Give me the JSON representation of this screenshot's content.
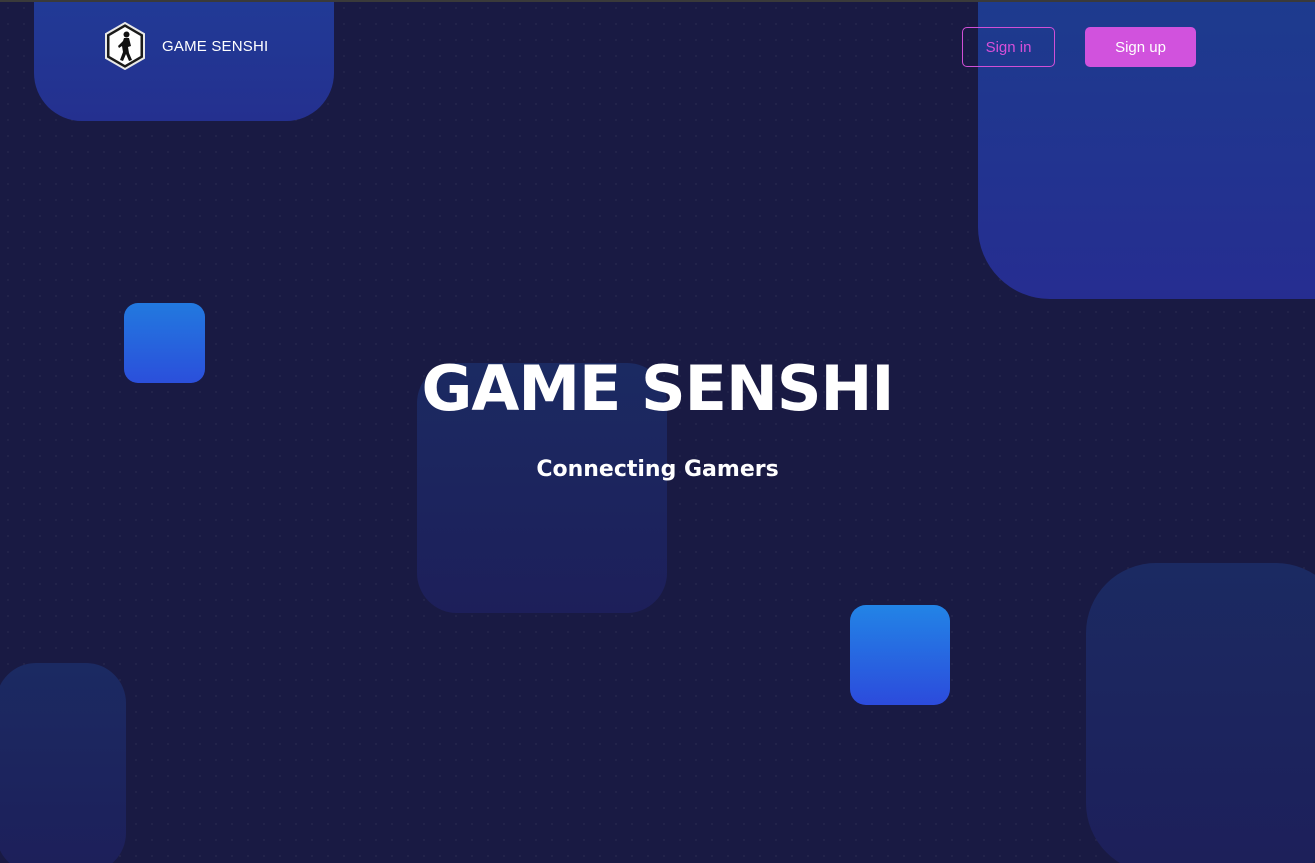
{
  "header": {
    "brand_name": "GAME SENSHI",
    "logo_icon": "runner-hexagon-logo-icon",
    "signin_label": "Sign in",
    "signup_label": "Sign up"
  },
  "hero": {
    "title": "GAME SENSHI",
    "subtitle": "Connecting Gamers"
  },
  "colors": {
    "background": "#191a43",
    "accent_pink": "#d152dd",
    "shape_blue": "#2279df",
    "shape_indigo": "#24308f"
  }
}
